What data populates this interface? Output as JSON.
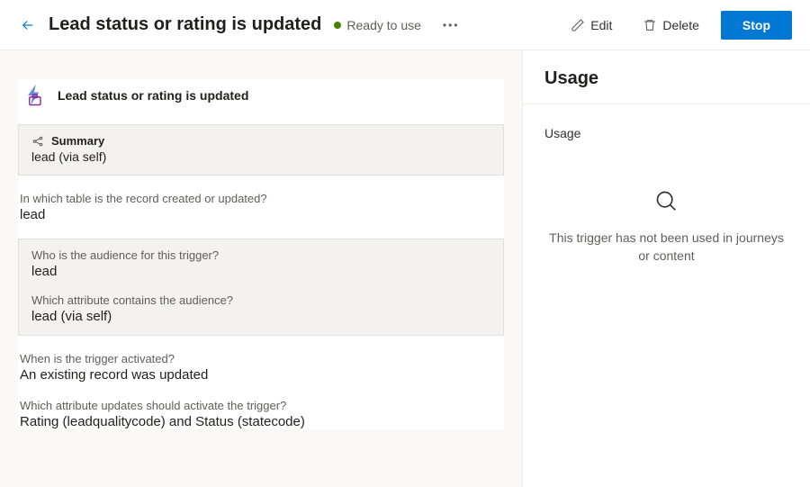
{
  "header": {
    "title": "Lead status or rating is updated",
    "status_label": "Ready to use",
    "edit_label": "Edit",
    "delete_label": "Delete",
    "stop_label": "Stop"
  },
  "main": {
    "card_title": "Lead status or rating is updated",
    "summary": {
      "label": "Summary",
      "value": "lead (via self)"
    },
    "table": {
      "label": "In which table is the record created or updated?",
      "value": "lead"
    },
    "audience": {
      "who_label": "Who is the audience for this trigger?",
      "who_value": "lead",
      "attr_label": "Which attribute contains the audience?",
      "attr_value": "lead (via self)"
    },
    "activation": {
      "label": "When is the trigger activated?",
      "value": "An existing record was updated"
    },
    "attributes": {
      "label": "Which attribute updates should activate the trigger?",
      "value": "Rating (leadqualitycode) and Status (statecode)"
    }
  },
  "right": {
    "title": "Usage",
    "section_label": "Usage",
    "empty_text": "This trigger has not been used in journeys or content"
  }
}
